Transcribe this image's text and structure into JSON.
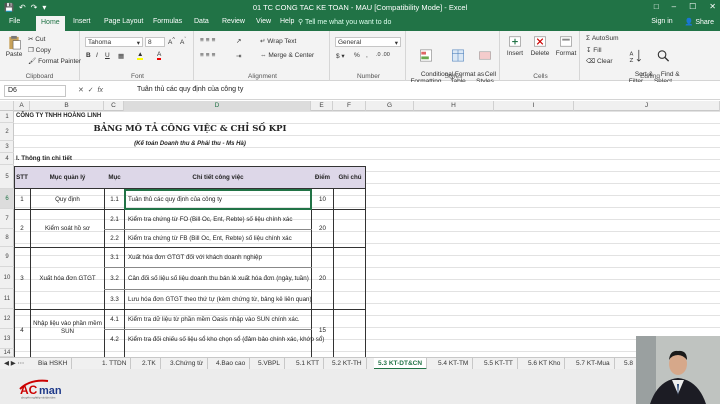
{
  "app": {
    "title": "01 TC CONG TAC KE TOAN - MAU  [Compatibility Mode]  -  Excel",
    "accent": "#217346"
  },
  "tabs": [
    "File",
    "Home",
    "Insert",
    "Page Layout",
    "Formulas",
    "Data",
    "Review",
    "View",
    "Help"
  ],
  "tell_me": "Tell me what you want to do",
  "account": {
    "signin": "Sign in",
    "share": "Share"
  },
  "ribbon": {
    "clipboard": {
      "paste": "Paste",
      "cut": "Cut",
      "copy": "Copy",
      "format_painter": "Format Painter",
      "label": "Clipboard"
    },
    "font": {
      "name": "Tahoma",
      "size": "8",
      "label": "Font"
    },
    "alignment": {
      "wrap": "Wrap Text",
      "merge": "Merge & Center",
      "label": "Alignment"
    },
    "number": {
      "format": "General",
      "label": "Number"
    },
    "styles": {
      "conditional": "Conditional\nFormatting",
      "format_table": "Format as\nTable",
      "cell_styles": "Cell\nStyles",
      "label": "Styles"
    },
    "cells": {
      "insert": "Insert",
      "delete": "Delete",
      "format": "Format",
      "label": "Cells"
    },
    "editing": {
      "autosum": "AutoSum",
      "fill": "Fill",
      "clear": "Clear",
      "sort": "Sort &\nFilter",
      "find": "Find &\nSelect",
      "label": "Editing"
    }
  },
  "namebox": "D6",
  "formula": "Tuân thủ các quy định của công ty",
  "columns": [
    "A",
    "B",
    "C",
    "D",
    "E",
    "F",
    "G",
    "H",
    "I",
    "J"
  ],
  "rows": [
    "1",
    "2",
    "3",
    "4",
    "5",
    "6",
    "7",
    "8",
    "9",
    "10",
    "11",
    "12",
    "13",
    "14"
  ],
  "sheet": {
    "company": "CÔNG TY TNHH HOÀNG LINH",
    "title": "BẢNG MÔ TẢ CÔNG VIỆC & CHỈ SỐ KPI",
    "subtitle": "(Kế toán Doanh thu & Phải thu  -  Ms Hà)",
    "section": "I. Thông tin chi tiết",
    "headers": {
      "stt": "STT",
      "muc_quan_ly": "Mục quản lý",
      "muc": "Mục",
      "chi_tiet": "Chi tiết công việc",
      "diem": "Điểm",
      "ghi_chu": "Ghi chú"
    },
    "groups": [
      {
        "stt": "1",
        "muc_quan_ly": "Quy định",
        "diem": "10"
      },
      {
        "stt": "2",
        "muc_quan_ly": "Kiểm soát hồ sơ",
        "diem": "20"
      },
      {
        "stt": "3",
        "muc_quan_ly": "Xuất hóa đơn GTGT",
        "diem": "20"
      },
      {
        "stt": "4",
        "muc_quan_ly": "Nhập liệu vào phần mềm SUN",
        "diem": "15"
      }
    ],
    "items": [
      {
        "muc": "1.1",
        "text": "Tuân thủ các quy định của công ty"
      },
      {
        "muc": "2.1",
        "text": "Kiểm tra chứng từ FO (Bill Oc, Ent, Rebte) số liệu chính xác"
      },
      {
        "muc": "2.2",
        "text": "Kiểm tra chứng từ FB (Bill Oc, Ent, Rebte) số liệu chính xác"
      },
      {
        "muc": "3.1",
        "text": "Xuất hóa đơn GTGT đối với khách doanh nghiệp"
      },
      {
        "muc": "3.2",
        "text": "Cân đối số liệu số liệu doanh thu bán lẻ xuất hóa đơn (ngày, tuần)"
      },
      {
        "muc": "3.3",
        "text": "Lưu hóa đơn GTGT theo thứ tự (kèm chứng từ, bảng kê liên quan)"
      },
      {
        "muc": "4.1",
        "text": "Kiểm tra dữ liệu từ phần mềm Oasis nhập vào SUN chính xác."
      },
      {
        "muc": "4.2",
        "text": "Kiểm tra đối chiếu số liệu sổ kho chọn sổ (đảm bảo chính xác, khớp sổ)"
      }
    ]
  },
  "sheet_tabs": [
    "Bia HSKH",
    "1. TTDN",
    "2.TK",
    "3.Chứng từ",
    "4.Bao cao",
    "5.VBPL",
    "5.1 KTT",
    "5.2 KT-TH",
    "5.3 KT-DT&CN",
    "5.4 KT-TM",
    "5.5 KT-TT",
    "5.6 KT Kho",
    "5.7 KT-Mua",
    "5.8"
  ],
  "active_sheet_tab": "5.3 KT-DT&CN",
  "brand": {
    "logo": "ACman",
    "tagline": "chuyên nghiệp và tận tâm"
  }
}
